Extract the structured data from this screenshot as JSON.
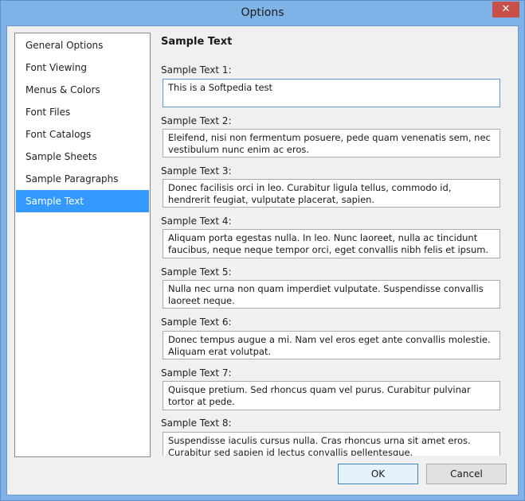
{
  "window": {
    "title": "Options"
  },
  "sidebar": {
    "items": [
      {
        "label": "General Options",
        "selected": false
      },
      {
        "label": "Font Viewing",
        "selected": false
      },
      {
        "label": "Menus & Colors",
        "selected": false
      },
      {
        "label": "Font Files",
        "selected": false
      },
      {
        "label": "Font Catalogs",
        "selected": false
      },
      {
        "label": "Sample Sheets",
        "selected": false
      },
      {
        "label": "Sample Paragraphs",
        "selected": false
      },
      {
        "label": "Sample Text",
        "selected": true
      }
    ]
  },
  "main": {
    "section_title": "Sample Text",
    "fields": [
      {
        "label": "Sample Text 1:",
        "value": "This is a Softpedia test",
        "focused": true
      },
      {
        "label": "Sample Text 2:",
        "value": "Eleifend, nisi non fermentum posuere, pede quam venenatis sem, nec vestibulum nunc enim ac eros."
      },
      {
        "label": "Sample Text 3:",
        "value": "Donec facilisis orci in leo. Curabitur ligula tellus, commodo id, hendrerit feugiat, vulputate placerat, sapien."
      },
      {
        "label": "Sample Text 4:",
        "value": "Aliquam porta egestas nulla. In leo. Nunc laoreet, nulla ac tincidunt faucibus, neque neque tempor orci, eget convallis nibh felis et ipsum."
      },
      {
        "label": "Sample Text 5:",
        "value": "Nulla nec urna non quam imperdiet vulputate. Suspendisse convallis laoreet neque."
      },
      {
        "label": "Sample Text 6:",
        "value": "Donec tempus augue a mi. Nam vel eros eget ante convallis molestie. Aliquam erat volutpat."
      },
      {
        "label": "Sample Text 7:",
        "value": "Quisque pretium. Sed rhoncus quam vel purus. Curabitur pulvinar tortor at pede."
      },
      {
        "label": "Sample Text 8:",
        "value": "Suspendisse iaculis cursus nulla. Cras rhoncus urna sit amet eros. Curabitur sed sapien id lectus convallis pellentesque."
      }
    ]
  },
  "footer": {
    "ok_label": "OK",
    "cancel_label": "Cancel"
  },
  "icons": {
    "close": "close-icon"
  },
  "colors": {
    "selection": "#3399ff",
    "titlebar": "#7fb2e6",
    "close": "#c7504b"
  }
}
